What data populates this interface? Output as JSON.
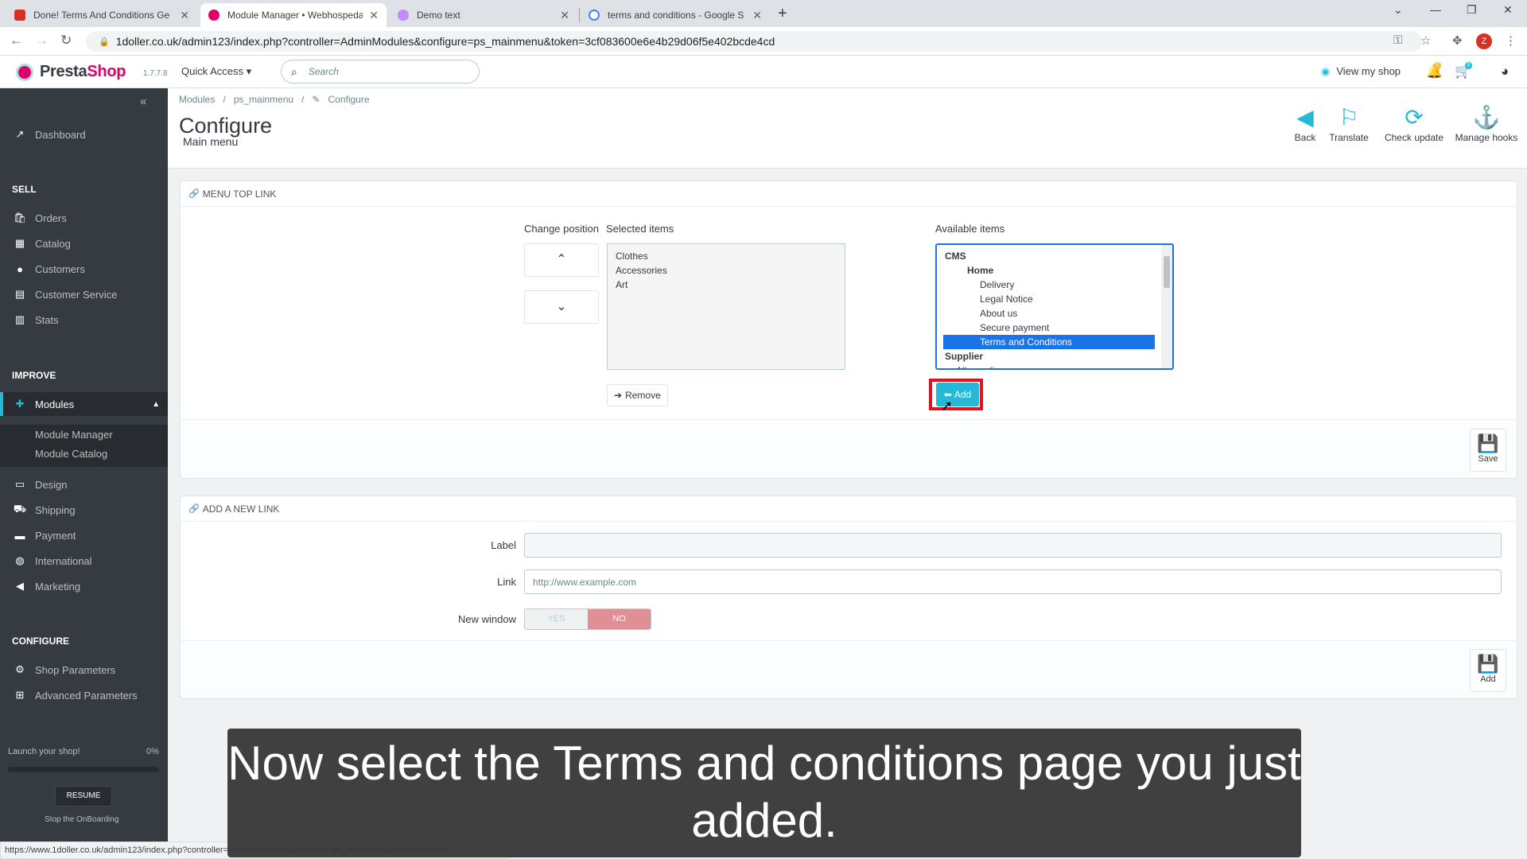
{
  "browser": {
    "tabs": [
      {
        "title": "Done! Terms And Conditions Ge",
        "color": "#d93025"
      },
      {
        "title": "Module Manager • Webhospeda",
        "color": "#df0067"
      },
      {
        "title": "Demo text",
        "color": "#c58af9"
      },
      {
        "title": "terms and conditions - Google S",
        "color": "#4285f4"
      }
    ],
    "url": "1doller.co.uk/admin123/index.php?controller=AdminModules&configure=ps_mainmenu&token=3cf083600e6e4b29d06f5e402bcde4cd",
    "profile_initial": "Z",
    "status_url": "https://www.1doller.co.uk/admin123/index.php?controller=AdminModules&configure=ps_mainmenu&token=3cf083..."
  },
  "header": {
    "logo_a": "Presta",
    "logo_b": "Shop",
    "version": "1.7.7.8",
    "quick_access": "Quick Access ▾",
    "search_placeholder": "Search",
    "view_shop": "View my shop",
    "notif_bell": "0",
    "notif_cart": "0"
  },
  "sidebar": {
    "dashboard": "Dashboard",
    "sell_title": "SELL",
    "sell": [
      "Orders",
      "Catalog",
      "Customers",
      "Customer Service",
      "Stats"
    ],
    "improve_title": "IMPROVE",
    "modules": "Modules",
    "modules_sub": [
      "Module Manager",
      "Module Catalog"
    ],
    "improve": [
      "Design",
      "Shipping",
      "Payment",
      "International",
      "Marketing"
    ],
    "configure_title": "CONFIGURE",
    "configure": [
      "Shop Parameters",
      "Advanced Parameters"
    ],
    "launch": "Launch your shop!",
    "launch_pct": "0%",
    "resume": "RESUME",
    "stop": "Stop the OnBoarding"
  },
  "page": {
    "breadcrumb": [
      "Modules",
      "/",
      "ps_mainmenu",
      "/",
      "Configure"
    ],
    "title": "Configure",
    "subtitle": "Main menu",
    "toolbar": [
      "Back",
      "Translate",
      "Check update",
      "Manage hooks"
    ]
  },
  "menu_top_link": {
    "heading": "MENU TOP LINK",
    "change_position": "Change position",
    "selected_label": "Selected items",
    "selected_items": [
      "Clothes",
      "Accessories",
      "Art"
    ],
    "available_label": "Available items",
    "available": [
      {
        "text": "CMS",
        "level": 0,
        "group": true
      },
      {
        "text": "Home",
        "level": 1,
        "group": true
      },
      {
        "text": "Delivery",
        "level": 2
      },
      {
        "text": "Legal Notice",
        "level": 2
      },
      {
        "text": "About us",
        "level": 2
      },
      {
        "text": "Secure payment",
        "level": 2
      },
      {
        "text": "Terms and Conditions",
        "level": 2,
        "selected": true
      },
      {
        "text": "Supplier",
        "level": 0,
        "group": true
      },
      {
        "text": "All suppliers",
        "level": 1
      }
    ],
    "remove": "Remove",
    "add": "Add",
    "save": "Save"
  },
  "new_link": {
    "heading": "ADD A NEW LINK",
    "label_label": "Label",
    "label_value": "",
    "link_label": "Link",
    "link_placeholder": "http://www.example.com",
    "new_window_label": "New window",
    "yes": "YES",
    "no": "NO",
    "add": "Add"
  },
  "caption": "Now select the Terms and conditions page you just added.",
  "colors": {
    "accent": "#25b9d7",
    "brand": "#df0067",
    "highlight": "#e5121d"
  }
}
